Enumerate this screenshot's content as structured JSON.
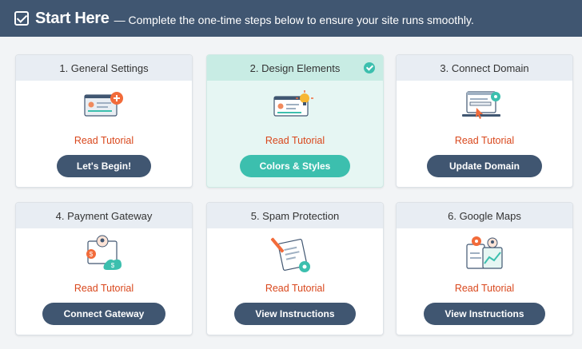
{
  "header": {
    "title": "Start Here",
    "subtitle": "— Complete the one-time steps below to ensure your site runs smoothly."
  },
  "colors": {
    "header": "#405671",
    "accent": "#3cbfae",
    "link": "#d9471c",
    "done_bg": "#e6f6f3"
  },
  "cards": [
    {
      "title": "1. General Settings",
      "link": "Read Tutorial",
      "button": "Let's Begin!",
      "icon": "settings-illustration-icon",
      "done": false
    },
    {
      "title": "2. Design Elements",
      "link": "Read Tutorial",
      "button": "Colors & Styles",
      "icon": "design-illustration-icon",
      "done": true
    },
    {
      "title": "3. Connect Domain",
      "link": "Read Tutorial",
      "button": "Update Domain",
      "icon": "domain-illustration-icon",
      "done": false
    },
    {
      "title": "4. Payment Gateway",
      "link": "Read Tutorial",
      "button": "Connect Gateway",
      "icon": "payment-illustration-icon",
      "done": false
    },
    {
      "title": "5. Spam Protection",
      "link": "Read Tutorial",
      "button": "View Instructions",
      "icon": "spam-illustration-icon",
      "done": false
    },
    {
      "title": "6. Google Maps",
      "link": "Read Tutorial",
      "button": "View Instructions",
      "icon": "maps-illustration-icon",
      "done": false
    }
  ]
}
